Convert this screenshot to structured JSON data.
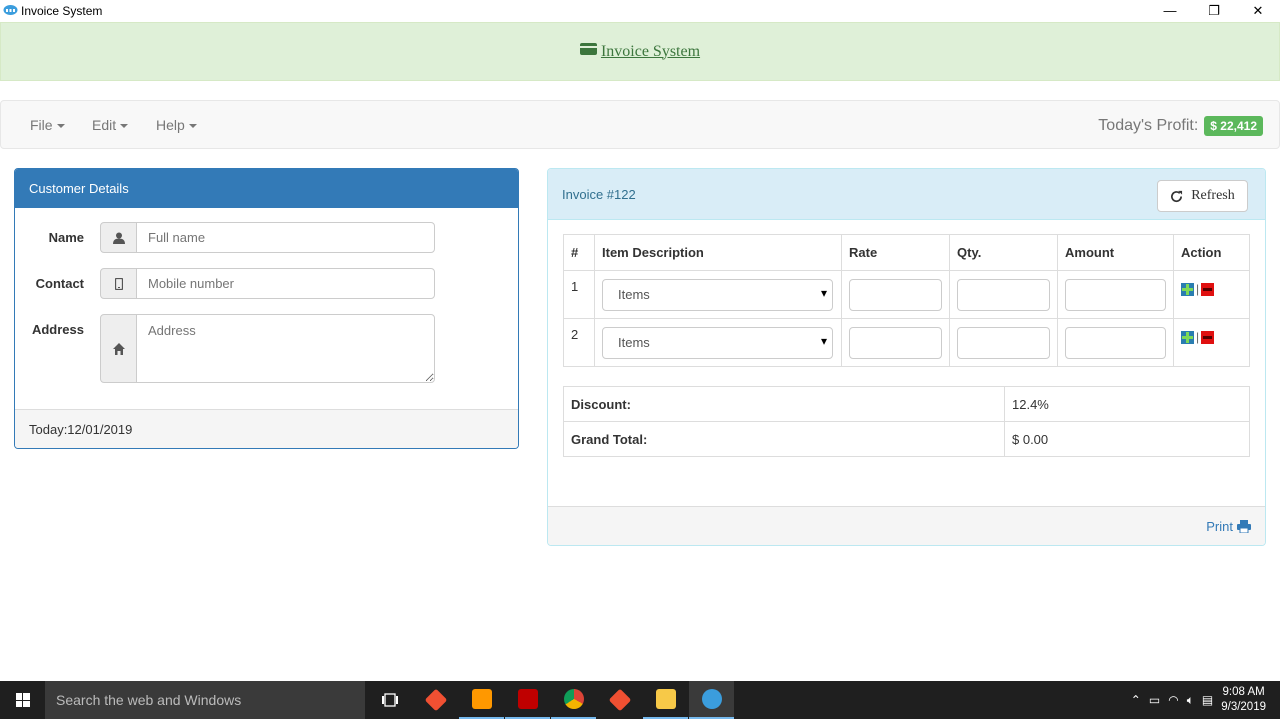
{
  "window": {
    "title": "Invoice System",
    "minimize": "—",
    "maximize": "❐",
    "close": "✕"
  },
  "banner": {
    "title": "Invoice System"
  },
  "menu": {
    "file": "File",
    "edit": "Edit",
    "help": "Help",
    "profit_label": "Today's Profit:",
    "profit_value": "$ 22,412"
  },
  "customer": {
    "heading": "Customer Details",
    "name_label": "Name",
    "name_placeholder": "Full name",
    "contact_label": "Contact",
    "contact_placeholder": "Mobile number",
    "address_label": "Address",
    "address_placeholder": "Address",
    "today": "Today:12/01/2019"
  },
  "invoice": {
    "title": "Invoice #122",
    "refresh": "Refresh",
    "columns": [
      "#",
      "Item Description",
      "Rate",
      "Qty.",
      "Amount",
      "Action"
    ],
    "rows": [
      {
        "num": "1",
        "item": "Items",
        "rate": "",
        "qty": "",
        "amount": ""
      },
      {
        "num": "2",
        "item": "Items",
        "rate": "",
        "qty": "",
        "amount": ""
      }
    ],
    "action_separator": "|",
    "discount_label": "Discount:",
    "discount_value": "12.4%",
    "grand_total_label": "Grand Total:",
    "grand_total_value": "$ 0.00",
    "print": "Print"
  },
  "taskbar": {
    "search_placeholder": "Search the web and Windows",
    "time": "9:08 AM",
    "date": "9/3/2019",
    "apps": [
      {
        "name": "task-view",
        "color": "#1f1f1f"
      },
      {
        "name": "git",
        "color": "#f05032"
      },
      {
        "name": "sublime-text",
        "color": "#ff9800"
      },
      {
        "name": "filezilla",
        "color": "#bf0000"
      },
      {
        "name": "chrome",
        "color": "#4caf50"
      },
      {
        "name": "git",
        "color": "#f05032"
      },
      {
        "name": "file-explorer",
        "color": "#f7c948"
      },
      {
        "name": "invoice-app",
        "color": "#3b9ddd"
      }
    ]
  },
  "colors": {
    "primary": "#337ab7",
    "success": "#5cb85c",
    "banner_bg": "#dff0d8",
    "info_bg": "#d9edf7"
  }
}
